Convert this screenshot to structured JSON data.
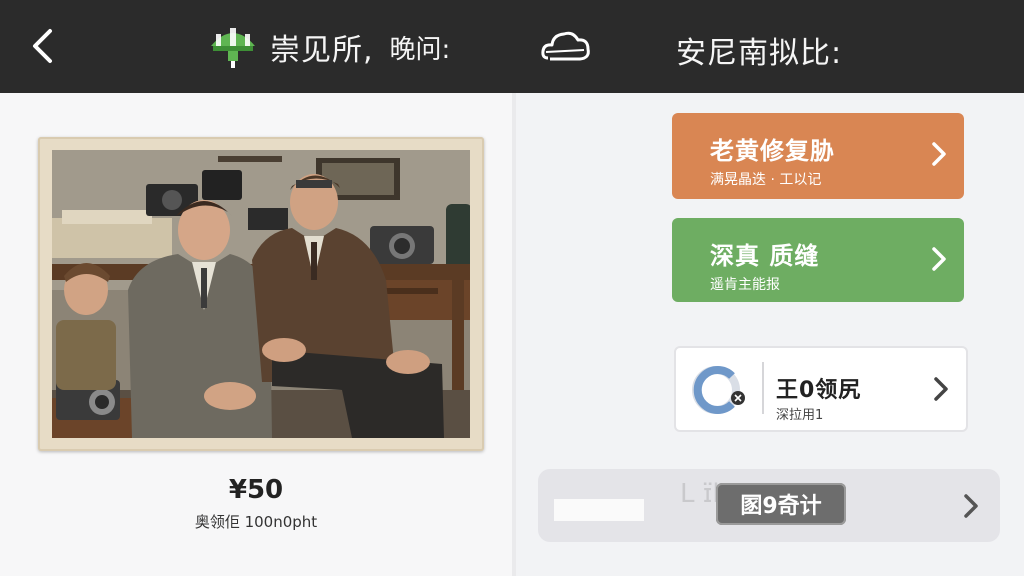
{
  "header": {
    "title": "崇见所,",
    "subtitle": "晚问:",
    "right_title": "安尼南拟比:",
    "back_icon": "chevron-left-icon",
    "app_icon": "green-umbrella-icon",
    "cloud_icon": "cloud-icon"
  },
  "photo": {
    "description_icon": "vintage-photo",
    "price": "¥50",
    "caption": "奥领佢 100n0pht"
  },
  "cards": {
    "repair": {
      "title": "老黄修复胁",
      "subtitle": "满晃晶迭 · 工以记",
      "color": "#d98653"
    },
    "enhance": {
      "title": "深真  质缝",
      "subtitle": "遥肯主能报",
      "color": "#6ead62"
    },
    "credits": {
      "title": "王0领尻",
      "subtitle": "深拉用1",
      "icon": "progress-ring-icon"
    },
    "timer": {
      "label": "圂9奇计",
      "ghost_text": "L  ɪ̈l"
    }
  }
}
